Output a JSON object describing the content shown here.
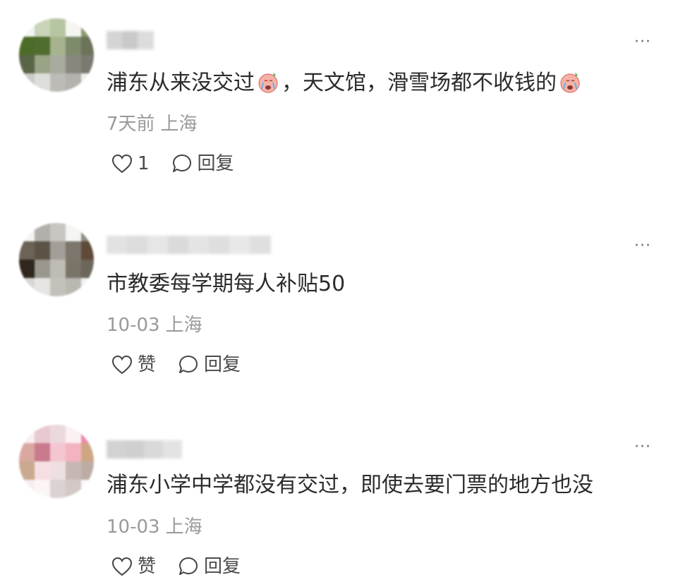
{
  "comments": [
    {
      "content": "浦东从来没交过",
      "content_mid": "，天文馆，滑雪场都不收钱的",
      "emoji_icon": "crying-face-emoji",
      "time": "7天前",
      "location": "上海",
      "like_label": "1",
      "reply_label": "回复",
      "more_label": "···",
      "avatar_colors": [
        "#f4f5f2",
        "#c9d4b8",
        "#b6c6a3",
        "#f5f6f2",
        "#8a9a6e",
        "#4d6b28",
        "#516c2f",
        "#a6b38e",
        "#7d8a6c",
        "#6b7358",
        "#5a6446",
        "#9aa385",
        "#a8aba0",
        "#88877c",
        "#7b7a70",
        "#c9ccc4",
        "#dedfdc",
        "#bcbbb6",
        "#b3b2ad",
        "#eeeeec"
      ],
      "username_colors": [
        "#d4d4d4",
        "#c9c9c9",
        "#dcdcdc"
      ]
    },
    {
      "content": "市教委每学期每人补贴50",
      "time": "10-03",
      "location": "上海",
      "like_label": "赞",
      "reply_label": "回复",
      "more_label": "···",
      "avatar_colors": [
        "#f4f4f3",
        "#b3b0ab",
        "#c8c6c2",
        "#f5f5f4",
        "#8f8c86",
        "#6b6356",
        "#5b5446",
        "#a39f98",
        "#7c766c",
        "#5e4a36",
        "#2f261d",
        "#9a978f",
        "#bfbcb6",
        "#7a7468",
        "#6c665b",
        "#d8d6d2",
        "#e6e5e3",
        "#c4c1bb",
        "#bab7b1",
        "#f2f2f1"
      ],
      "username_colors": [
        "#e2e2e2",
        "#dcdcdc",
        "#e6e6e6",
        "#dadada",
        "#e4e4e4",
        "#dedede",
        "#e8e8e8",
        "#dfdfdf"
      ]
    },
    {
      "content": "浦东小学中学都没有交过，即使去要门票的地方也没",
      "time": "10-03",
      "location": "上海",
      "like_label": "赞",
      "reply_label": "回复",
      "more_label": "···",
      "avatar_colors": [
        "#f9eef0",
        "#e7c9cf",
        "#ecd9dc",
        "#fbf1f3",
        "#f08aa9",
        "#d9a8a0",
        "#c97a8c",
        "#f3c6d2",
        "#f3b4c0",
        "#cfa684",
        "#c9a98f",
        "#f6dfe3",
        "#eee0e0",
        "#c7b7b2",
        "#bdaca6",
        "#f7eeef",
        "#fbf5f5",
        "#dcd2d1",
        "#d3c8c6",
        "#fdf9f9"
      ],
      "username_colors": [
        "#d2d2d2",
        "#cfcfcf",
        "#d9d9d9",
        "#e3e3e3"
      ]
    }
  ]
}
